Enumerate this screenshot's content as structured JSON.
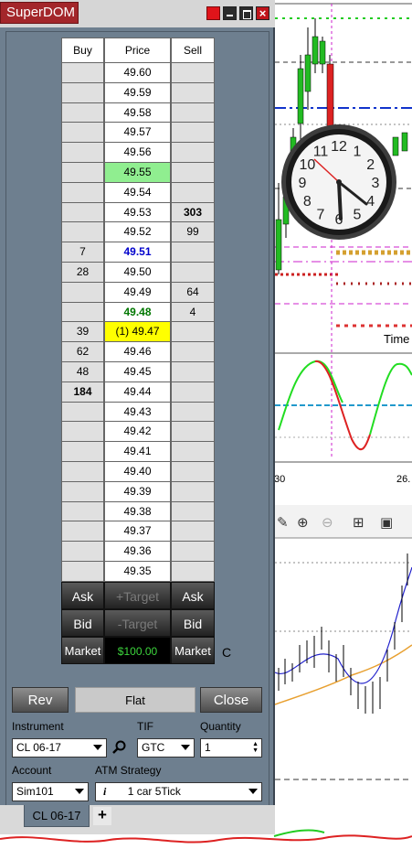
{
  "window": {
    "title": "SuperDOM"
  },
  "ladder": {
    "headers": {
      "buy": "Buy",
      "price": "Price",
      "sell": "Sell"
    },
    "rows": [
      {
        "buy": "",
        "price": "49.60",
        "sell": ""
      },
      {
        "buy": "",
        "price": "49.59",
        "sell": ""
      },
      {
        "buy": "",
        "price": "49.58",
        "sell": ""
      },
      {
        "buy": "",
        "price": "49.57",
        "sell": ""
      },
      {
        "buy": "",
        "price": "49.56",
        "sell": ""
      },
      {
        "buy": "",
        "price": "49.55",
        "sell": "",
        "price_style": "ask-green"
      },
      {
        "buy": "",
        "price": "49.54",
        "sell": ""
      },
      {
        "buy": "",
        "price": "49.53",
        "sell": "303",
        "sell_bold": true
      },
      {
        "buy": "",
        "price": "49.52",
        "sell": "99"
      },
      {
        "buy": "7",
        "price": "49.51",
        "sell": "",
        "price_style": "txt-blue"
      },
      {
        "buy": "28",
        "price": "49.50",
        "sell": ""
      },
      {
        "buy": "",
        "price": "49.49",
        "sell": "64"
      },
      {
        "buy": "",
        "price": "49.48",
        "sell": "4",
        "price_style": "txt-green"
      },
      {
        "buy": "39",
        "price": "(1) 49.47",
        "sell": "",
        "price_style": "last-yellow"
      },
      {
        "buy": "62",
        "price": "49.46",
        "sell": ""
      },
      {
        "buy": "48",
        "price": "49.45",
        "sell": ""
      },
      {
        "buy": "184",
        "price": "49.44",
        "sell": "",
        "buy_bold": true
      },
      {
        "buy": "",
        "price": "49.43",
        "sell": ""
      },
      {
        "buy": "",
        "price": "49.42",
        "sell": ""
      },
      {
        "buy": "",
        "price": "49.41",
        "sell": ""
      },
      {
        "buy": "",
        "price": "49.40",
        "sell": ""
      },
      {
        "buy": "",
        "price": "49.39",
        "sell": ""
      },
      {
        "buy": "",
        "price": "49.38",
        "sell": ""
      },
      {
        "buy": "",
        "price": "49.37",
        "sell": ""
      },
      {
        "buy": "",
        "price": "49.36",
        "sell": ""
      },
      {
        "buy": "",
        "price": "49.35",
        "sell": ""
      }
    ]
  },
  "order_buttons": {
    "ask_left": "Ask",
    "plus_target": "+Target",
    "ask_right": "Ask",
    "bid_left": "Bid",
    "minus_target": "-Target",
    "bid_right": "Bid",
    "market_left": "Market",
    "pnl": "$100.00",
    "market_right": "Market",
    "c_label": "C"
  },
  "controls": {
    "rev": "Rev",
    "flat": "Flat",
    "close": "Close",
    "instrument_label": "Instrument",
    "instrument_value": "CL 06-17",
    "tif_label": "TIF",
    "tif_value": "GTC",
    "quantity_label": "Quantity",
    "quantity_value": "1",
    "account_label": "Account",
    "account_value": "Sim101",
    "atm_label": "ATM Strategy",
    "atm_value": "1 car 5Tick"
  },
  "tabs": {
    "active": "CL 06-17",
    "add": "+"
  },
  "chart": {
    "label_time": "Time",
    "label_30": "30",
    "label_26": "26.",
    "clock_numbers": [
      "12",
      "1",
      "2",
      "3",
      "4",
      "5",
      "6",
      "7",
      "8",
      "9",
      "10",
      "11"
    ]
  }
}
